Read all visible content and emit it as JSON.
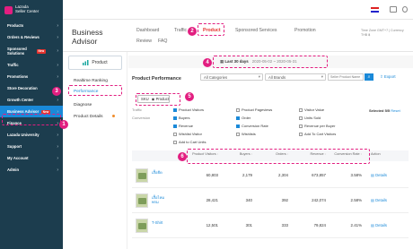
{
  "app": {
    "logo_line1": "Lazada",
    "logo_line2": "Seller Center"
  },
  "sidebar": {
    "items": [
      {
        "label": "Products"
      },
      {
        "label": "Orders & Reviews"
      },
      {
        "label": "Sponsored Solutions",
        "badge": "New"
      },
      {
        "label": "Traffic"
      },
      {
        "label": "Promotions"
      },
      {
        "label": "Store Decoration"
      },
      {
        "label": "Growth Center"
      },
      {
        "label": "Business Advisor",
        "badge": "New"
      },
      {
        "label": "Finance"
      },
      {
        "label": "Lazada University"
      },
      {
        "label": "Support"
      },
      {
        "label": "My Account"
      },
      {
        "label": "Admin"
      }
    ]
  },
  "header": {
    "title_line1": "Business",
    "title_line2": "Advisor",
    "nav": [
      "Dashboard",
      "Traffic",
      "Product",
      "Sponsored Services",
      "Promotion",
      "Review",
      "FAQ"
    ],
    "timezone_line1": "Time Zone GMT+7 | Currency",
    "timezone_line2": "THB ฿"
  },
  "left_menu": {
    "tab_label": "Product",
    "items": [
      "Realtime Ranking",
      "Performance",
      "Diagnose",
      "Product Details"
    ]
  },
  "date": {
    "label": "Last 30 days",
    "range": "2020-05-02 ~ 2020-05-31"
  },
  "performance": {
    "title": "Product Performance",
    "category_select": "All Categories",
    "brand_select": "All Brands",
    "search_placeholder": "Seller Product Name",
    "export_label": "Export",
    "segment": [
      "SKU",
      "Product"
    ]
  },
  "metrics": {
    "traffic_label": "Traffic",
    "conversion_label": "Conversion",
    "selected_label": "Selected 5/5",
    "reset_label": "Reset",
    "options": [
      {
        "label": "Product Visitors",
        "checked": true
      },
      {
        "label": "Product Pageviews",
        "checked": false
      },
      {
        "label": "Visitor Value",
        "checked": false
      },
      {
        "label": "Buyers",
        "checked": true
      },
      {
        "label": "Order",
        "checked": true
      },
      {
        "label": "Units Sold",
        "checked": false
      },
      {
        "label": "Revenue",
        "checked": true
      },
      {
        "label": "Conversion Rate",
        "checked": true
      },
      {
        "label": "Revenue per Buyer",
        "checked": false
      },
      {
        "label": "Wishlist Visitor",
        "checked": false
      },
      {
        "label": "Wishlists",
        "checked": false
      },
      {
        "label": "Add To Cart Visitors",
        "checked": false
      },
      {
        "label": "Add to Cart Units",
        "checked": false
      }
    ]
  },
  "table": {
    "columns": [
      "Product Visitors",
      "Buyers",
      "Orders",
      "Revenue",
      "Conversion Rate",
      "Action"
    ],
    "rows": [
      {
        "name": "เสื้อยืด",
        "visitors": "60,803",
        "buyers": "2,179",
        "orders": "2,304",
        "revenue": "673,857",
        "conv": "3.58%",
        "action": "Details"
      },
      {
        "name": "เสื้อไหมพรม",
        "visitors": "28,421",
        "buyers": "340",
        "orders": "392",
        "revenue": "242,074",
        "conv": "2.58%",
        "action": "Details"
      },
      {
        "name": "T-Shirt",
        "visitors": "12,501",
        "buyers": "301",
        "orders": "333",
        "revenue": "79,824",
        "conv": "2.41%",
        "action": "Details"
      }
    ]
  },
  "callouts": [
    "1",
    "2",
    "3",
    "4",
    "5",
    "6"
  ]
}
